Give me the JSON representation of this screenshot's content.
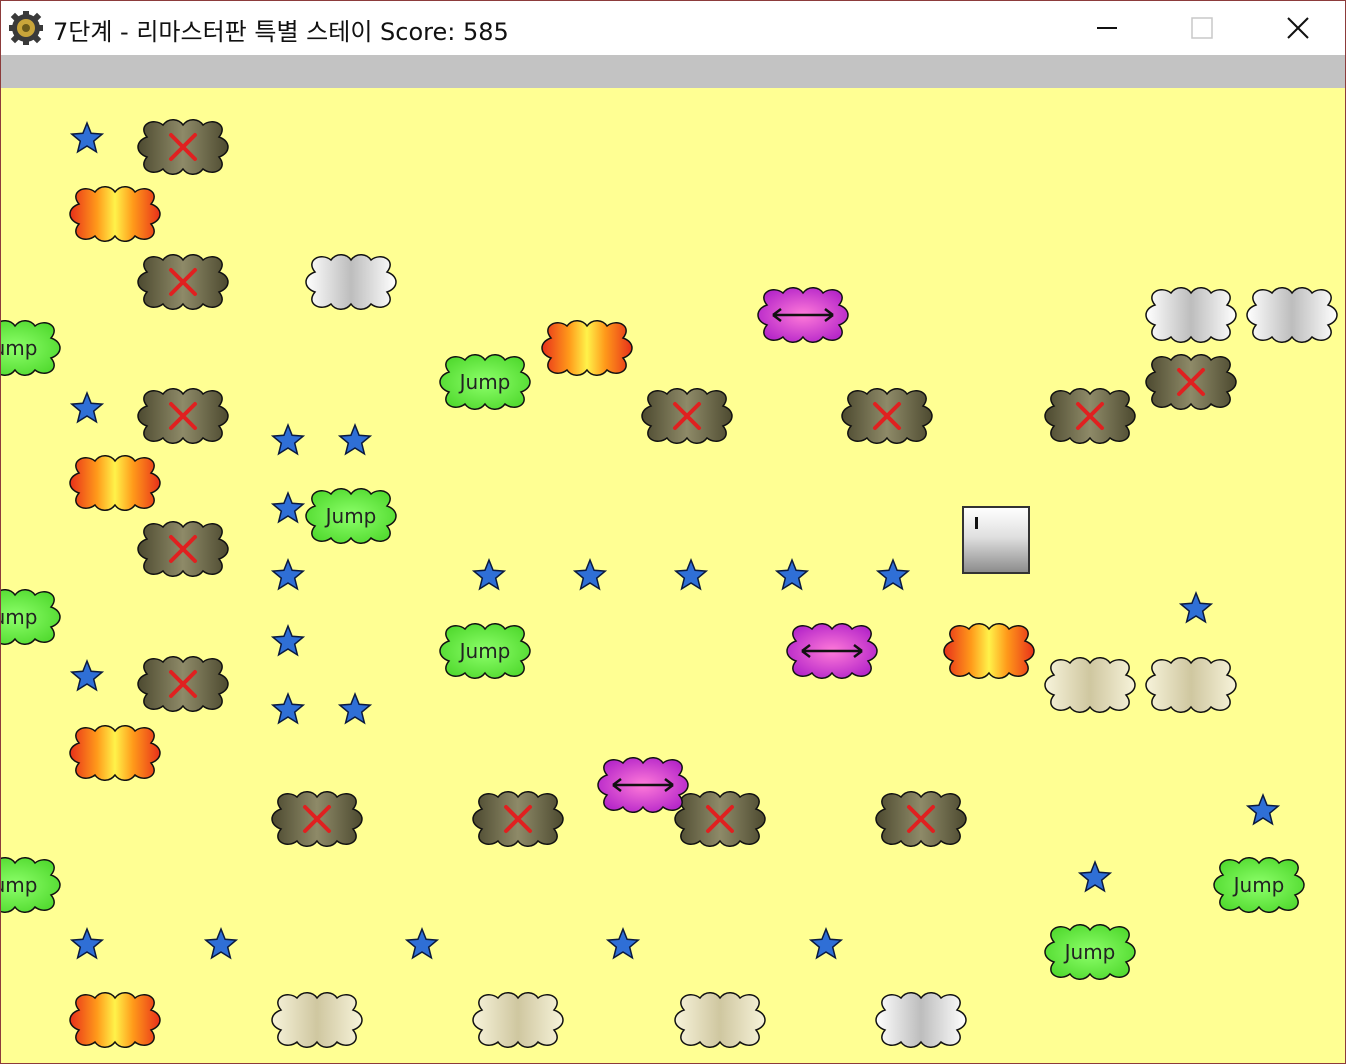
{
  "window": {
    "title": "7단계 - 리마스터판 특별 스테이 Score: 585",
    "minimize_icon": "minimize-icon",
    "maximize_icon": "maximize-icon",
    "close_icon": "close-icon",
    "app_icon": "gear-icon"
  },
  "game": {
    "jump_label": "Jump",
    "partial_jump_label": "ump",
    "colors": {
      "background": "#ffff93",
      "menubar": "#c3c3c3",
      "star": "#2f6fd6",
      "x_mark": "#e02020",
      "jump_cloud": "#6ef04a",
      "move_cloud": "#d633c8"
    }
  }
}
